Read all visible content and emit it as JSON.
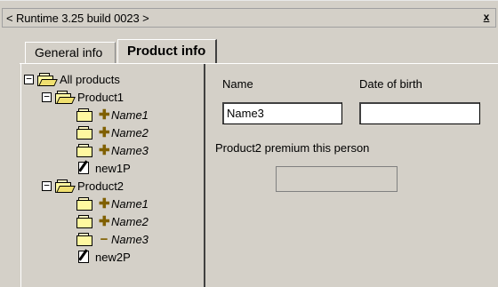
{
  "window": {
    "title": "< Runtime 3.25 build 0023 >",
    "close_label": "x"
  },
  "tabs": [
    {
      "label": "General info",
      "active": false
    },
    {
      "label": "Product info",
      "active": true
    }
  ],
  "tree": {
    "root": {
      "label": "All products",
      "expander": "−"
    },
    "product1": {
      "label": "Product1",
      "expander": "−"
    },
    "p1_items": [
      {
        "marker": "✚",
        "label": "Name1"
      },
      {
        "marker": "✚",
        "label": "Name2"
      },
      {
        "marker": "✚",
        "label": "Name3"
      }
    ],
    "p1_new": {
      "label": "new1P"
    },
    "product2": {
      "label": "Product2",
      "expander": "−"
    },
    "p2_items": [
      {
        "marker": "✚",
        "label": "Name1"
      },
      {
        "marker": "✚",
        "label": "Name2"
      },
      {
        "marker": "−",
        "label": "Name3"
      }
    ],
    "p2_new": {
      "label": "new2P"
    }
  },
  "form": {
    "name_label": "Name",
    "name_value": "Name3",
    "dob_label": "Date of birth",
    "dob_value": "",
    "premium_label": "Product2 premium this person",
    "premium_value": ""
  }
}
